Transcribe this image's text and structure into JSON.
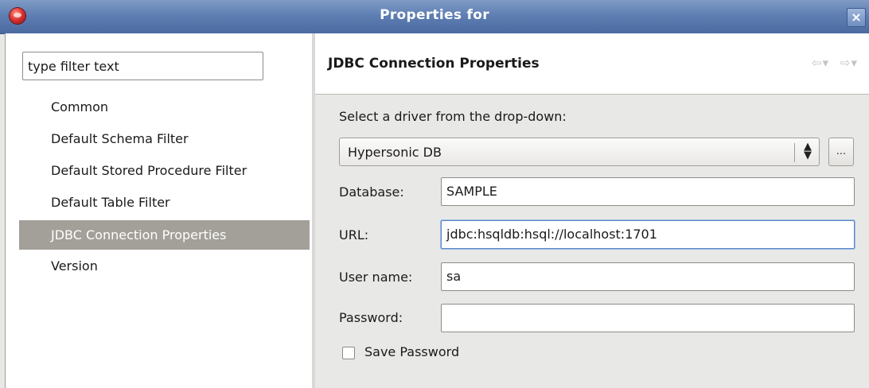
{
  "window": {
    "title": "Properties for",
    "close_label": "×"
  },
  "sidebar": {
    "filter_placeholder": "type filter text",
    "filter_value": "type filter text",
    "items": [
      {
        "label": "Common",
        "selected": false
      },
      {
        "label": "Default Schema Filter",
        "selected": false
      },
      {
        "label": "Default Stored Procedure Filter",
        "selected": false
      },
      {
        "label": "Default Table Filter",
        "selected": false
      },
      {
        "label": "JDBC Connection Properties",
        "selected": true
      },
      {
        "label": "Version",
        "selected": false
      }
    ]
  },
  "page": {
    "title": "JDBC Connection Properties",
    "back_arrow": "⇦▾",
    "forward_arrow": "⇨▾"
  },
  "form": {
    "driver_prompt": "Select a driver from the drop-down:",
    "driver_value": "Hypersonic DB",
    "driver_spinner": "▲▼",
    "browse_label": "...",
    "database_label": "Database:",
    "database_value": "SAMPLE",
    "url_label": "URL:",
    "url_value": "jdbc:hsqldb:hsql://localhost:1701",
    "username_label": "User name:",
    "username_value": "sa",
    "password_label": "Password:",
    "password_value": "",
    "save_password_label": "Save Password",
    "save_password_checked": false
  },
  "colors": {
    "titlebar": "#5f7fb3",
    "selection": "#a39f99",
    "focus": "#5b86c6"
  }
}
